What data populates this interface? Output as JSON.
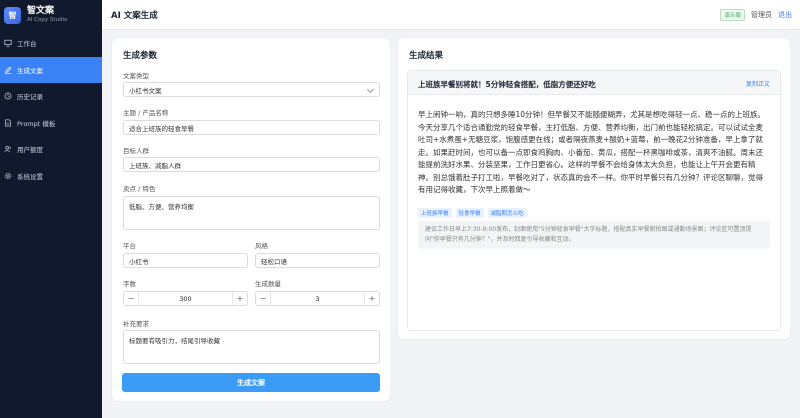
{
  "brand": {
    "name": "智文案",
    "subtitle": "AI Copy Studio",
    "logo_char": "智"
  },
  "sidebar": {
    "items": [
      {
        "label": "工作台",
        "icon": "monitor-icon",
        "active": false
      },
      {
        "label": "生成文案",
        "icon": "pen-icon",
        "active": true
      },
      {
        "label": "历史记录",
        "icon": "history-icon",
        "active": false
      },
      {
        "label": "Prompt 模板",
        "icon": "document-icon",
        "active": false
      },
      {
        "label": "用户额度",
        "icon": "users-icon",
        "active": false
      },
      {
        "label": "系统设置",
        "icon": "gear-icon",
        "active": false
      }
    ]
  },
  "header": {
    "title": "AI 文案生成",
    "badge": "演示版",
    "admin": "管理员",
    "logout": "退出"
  },
  "form": {
    "title": "生成参数",
    "type_label": "文案类型",
    "type_value": "小红书文案",
    "topic_label": "主题 / 产品名称",
    "topic_value": "适合上班族的轻食早餐",
    "audience_label": "目标人群",
    "audience_value": "上班族、减脂人群",
    "selling_label": "卖点 / 特色",
    "selling_value": "低脂、方便、营养均衡",
    "platform_label": "平台",
    "platform_value": "小红书",
    "style_label": "风格",
    "style_value": "轻松口语",
    "words_label": "字数",
    "words_value": "300",
    "count_label": "生成数量",
    "count_value": "3",
    "extra_label": "补充要求",
    "extra_value": "标题要有吸引力，结尾引导收藏",
    "minus": "−",
    "plus": "+",
    "submit": "生成文案"
  },
  "result": {
    "title": "生成结果",
    "card_title": "上班族早餐别将就！5分钟轻食搭配，低脂方便还好吃",
    "copy": "复制正文",
    "body": "早上闹钟一响，真的只想多睡10分钟！但早餐又不能随便糊弄，尤其是想吃得轻一点、稳一点的上班族。今天分享几个适合通勤党的轻食早餐，主打低脂、方便、营养均衡，出门前也能轻松搞定。可以试试全麦吐司+水煮蛋+无糖豆浆，饱腹感更在线；或者隔夜燕麦+酸奶+蓝莓，前一晚花2分钟准备，早上拿了就走。如果赶时间，也可以备一点即食鸡胸肉、小番茄、黄瓜，搭配一杯黑咖啡或茶，清爽不油腻。周末还能提前洗好水果、分装坚果，工作日更省心。这样的早餐不会给身体太大负担，也能让上午开会更有精神。别总饿着肚子打工啦，早餐吃对了，状态真的会不一样。你平时早餐只有几分钟？评论区聊聊，觉得有用记得收藏，下次早上照着做～",
    "tags": [
      "上班族早餐",
      "轻食早餐",
      "减脂期怎么吃"
    ],
    "hint": "建议工作日早上7:30-9:00发布，封面使用\"5分钟轻食早餐\"大字标题，搭配真实早餐俯拍图或通勤场景图；评论区可置顶提问\"你早餐只有几分钟？\"，并及时回复引导收藏和互动。"
  }
}
